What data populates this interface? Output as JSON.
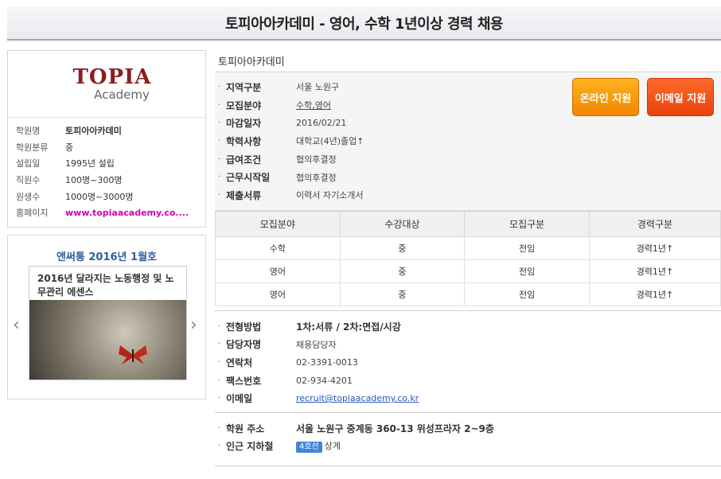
{
  "page": {
    "title": "토피아아카데미 - 영어, 수학 1년이상 경력 채용"
  },
  "academy": {
    "logo_main": "TOPIA",
    "logo_sub": "Academy",
    "info": [
      {
        "label": "학원명",
        "value": "토피아아카데미"
      },
      {
        "label": "학원분류",
        "value": "중"
      },
      {
        "label": "설립일",
        "value": "1995년 설립"
      },
      {
        "label": "직원수",
        "value": "100명~300명"
      },
      {
        "label": "원생수",
        "value": "1000명~3000명"
      },
      {
        "label": "홈페이지",
        "value": "www.topiaacademy.co...."
      }
    ]
  },
  "promo": {
    "title": "앤써통 2016년 1월호",
    "banner_text": "2016년 달라지는 노동행정 및 노무관리 에센스",
    "prev_icon": "chevron-left-icon",
    "next_icon": "chevron-right-icon"
  },
  "job": {
    "company_name": "토피아아카데미",
    "details": [
      {
        "label": "지역구분",
        "value": "서울 노원구"
      },
      {
        "label": "모집분야",
        "value": "수학,영어"
      },
      {
        "label": "마감일자",
        "value": "2016/02/21"
      },
      {
        "label": "학력사항",
        "value": "대학교(4년)졸업↑"
      },
      {
        "label": "급여조건",
        "value": "협의후결정"
      },
      {
        "label": "근무시작일",
        "value": "협의후결정"
      },
      {
        "label": "제출서류",
        "value": "이력서  자기소개서"
      }
    ],
    "buttons": {
      "online_apply": "온라인 지원",
      "email_apply": "이메일 지원"
    },
    "table": {
      "headers": [
        "모집분야",
        "수강대상",
        "모집구분",
        "경력구분"
      ],
      "rows": [
        [
          "수학",
          "중",
          "전임",
          "경력1년↑"
        ],
        [
          "영어",
          "중",
          "전임",
          "경력1년↑"
        ],
        [
          "영어",
          "중",
          "전임",
          "경력1년↑"
        ]
      ]
    },
    "process": [
      {
        "label": "전형방법",
        "value": "1차:서류  / 2차:면접/시강"
      },
      {
        "label": "담당자명",
        "value": "채용담당자"
      },
      {
        "label": "연락처",
        "value": "02-3391-0013"
      },
      {
        "label": "팩스번호",
        "value": "02-934-4201"
      },
      {
        "label": "이메일",
        "value": "recruit@topiaacademy.co.kr"
      }
    ],
    "address": {
      "address_label": "학원 주소",
      "address_value": "서울 노원구 중계동 360-13 위성프라자 2~9층",
      "subway_label": "인근 지하철",
      "subway_line": "4호선",
      "subway_station": "상계"
    }
  },
  "colors": {
    "online_button": "#f59a0e",
    "email_button": "#f05416",
    "homepage_link": "#d000b4",
    "promo_title": "#2f5f9e",
    "subway_badge": "#3e86d8"
  }
}
